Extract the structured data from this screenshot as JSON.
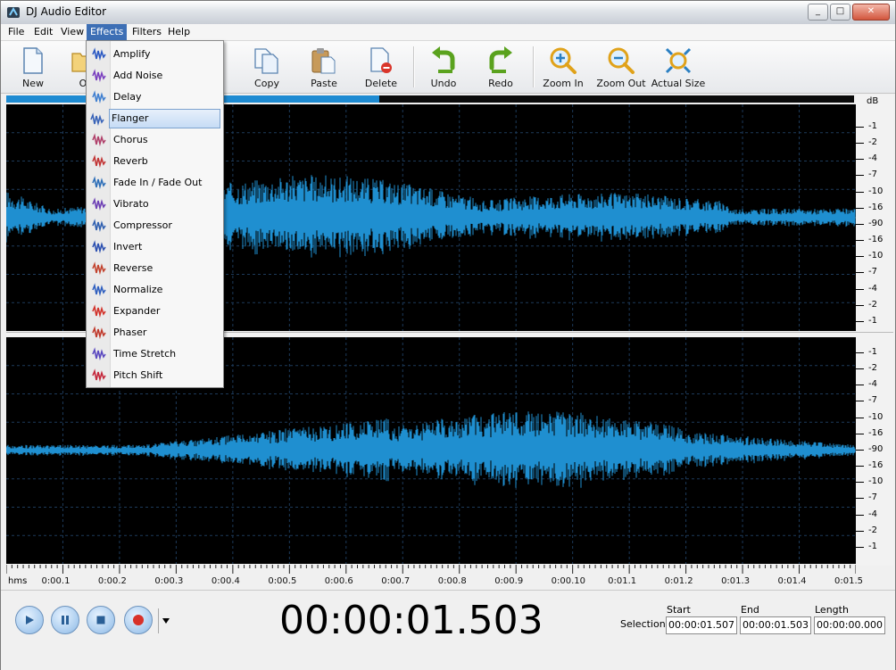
{
  "window": {
    "title": "DJ Audio Editor",
    "controls": [
      "_",
      "□",
      "✕"
    ]
  },
  "menubar": {
    "items": [
      "File",
      "Edit",
      "View",
      "Effects",
      "Filters",
      "Help"
    ],
    "active": "Effects"
  },
  "toolbar": {
    "new": "New",
    "open": "O",
    "copy": "Copy",
    "paste": "Paste",
    "delete": "Delete",
    "undo": "Undo",
    "redo": "Redo",
    "zoom_in": "Zoom In",
    "zoom_out": "Zoom Out",
    "actual_size": "Actual Size"
  },
  "effects_menu": {
    "highlighted": "Flanger",
    "items": [
      "Amplify",
      "Add Noise",
      "Delay",
      "Flanger",
      "Chorus",
      "Reverb",
      "Fade In / Fade Out",
      "Vibrato",
      "Compressor",
      "Invert",
      "Reverse",
      "Normalize",
      "Expander",
      "Phaser",
      "Time Stretch",
      "Pitch Shift"
    ]
  },
  "playback_progress": 0.44,
  "db_scale": {
    "unit": "dB",
    "channel1": [
      "-1",
      "-2",
      "-4",
      "-7",
      "-10",
      "-16",
      "-90",
      "-16",
      "-10",
      "-7",
      "-4",
      "-2",
      "-1"
    ],
    "channel2": [
      "-1",
      "-2",
      "-4",
      "-7",
      "-10",
      "-16",
      "-90",
      "-16",
      "-10",
      "-7",
      "-4",
      "-2",
      "-1"
    ]
  },
  "timeline": {
    "unit": "hms",
    "labels": [
      "0:00.1",
      "0:00.2",
      "0:00.3",
      "0:00.4",
      "0:00.5",
      "0:00.6",
      "0:00.7",
      "0:00.8",
      "0:00.9",
      "0:00.10",
      "0:01.1",
      "0:01.2",
      "0:01.3",
      "0:01.4",
      "0:01.5"
    ]
  },
  "transport": {
    "current_time": "00:00:01.503"
  },
  "selection": {
    "label": "Selection",
    "start_label": "Start",
    "start": "00:00:01.507",
    "end_label": "End",
    "end": "00:00:01.503",
    "length_label": "Length",
    "length": "00:00:00.000"
  },
  "colors": {
    "waveform": "#1f8fd0",
    "background": "#000000",
    "menu_highlight": "#c6dcf5"
  }
}
